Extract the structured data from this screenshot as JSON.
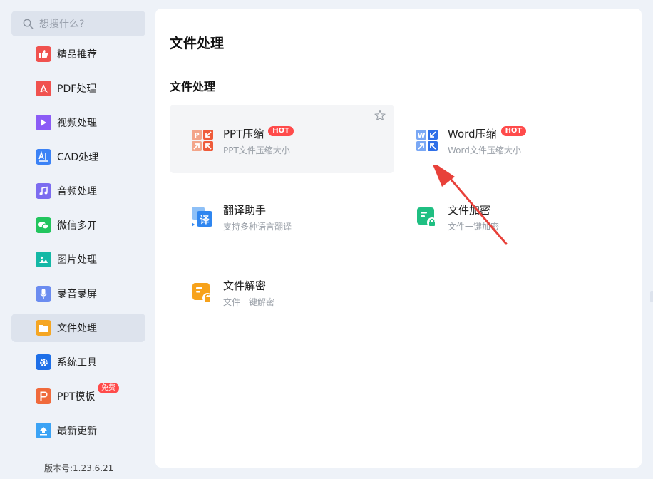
{
  "search": {
    "placeholder": "想搜什么?"
  },
  "sidebar": {
    "items": [
      {
        "label": "精品推荐",
        "icon": "thumbs-up-icon",
        "color": "#f0524f"
      },
      {
        "label": "PDF处理",
        "icon": "pdf-icon",
        "color": "#f0524f"
      },
      {
        "label": "视频处理",
        "icon": "video-play-icon",
        "color": "#8b5cf6"
      },
      {
        "label": "CAD处理",
        "icon": "cad-icon",
        "color": "#3b82f6"
      },
      {
        "label": "音频处理",
        "icon": "music-note-icon",
        "color": "#7c6cf0"
      },
      {
        "label": "微信多开",
        "icon": "wechat-icon",
        "color": "#22c55e"
      },
      {
        "label": "图片处理",
        "icon": "image-icon",
        "color": "#14b8a6"
      },
      {
        "label": "录音录屏",
        "icon": "microphone-icon",
        "color": "#6b8cf0"
      },
      {
        "label": "文件处理",
        "icon": "folder-icon",
        "color": "#f5a623",
        "active": true
      },
      {
        "label": "系统工具",
        "icon": "gear-icon",
        "color": "#1e6fe8"
      },
      {
        "label": "PPT模板",
        "icon": "ppt-icon",
        "color": "#f06a3c",
        "badge": "免费"
      },
      {
        "label": "最新更新",
        "icon": "upload-icon",
        "color": "#3ba3f5"
      }
    ],
    "version": "版本号:1.23.6.21"
  },
  "main": {
    "page_title": "文件处理",
    "section_title": "文件处理",
    "cards": [
      {
        "name": "PPT压缩",
        "desc": "PPT文件压缩大小",
        "badge": "HOT",
        "icon": "ppt-compress-icon"
      },
      {
        "name": "Word压缩",
        "desc": "Word文件压缩大小",
        "badge": "HOT",
        "icon": "word-compress-icon"
      },
      {
        "name": "翻译助手",
        "desc": "支持多种语言翻译",
        "icon": "translate-icon"
      },
      {
        "name": "文件加密",
        "desc": "文件一键加密",
        "icon": "file-encrypt-icon"
      },
      {
        "name": "文件解密",
        "desc": "文件一键解密",
        "icon": "file-decrypt-icon"
      }
    ]
  },
  "colors": {
    "hot_badge": "#ff4b4b",
    "arrow": "#e8413a",
    "active_bg": "#dde3ed"
  }
}
